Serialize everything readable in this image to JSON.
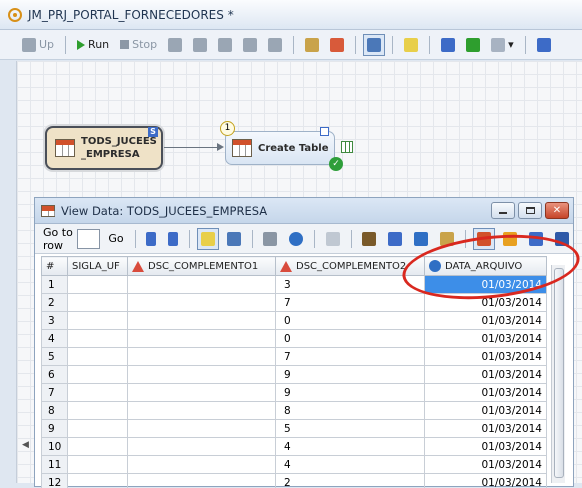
{
  "window": {
    "title": "JM_PRJ_PORTAL_FORNECEDORES *"
  },
  "toolbar": {
    "up_label": "Up",
    "run_label": "Run",
    "stop_label": "Stop"
  },
  "flow": {
    "source_node_line1": "TODS_JUCEES",
    "source_node_line2": "_EMPRESA",
    "source_badge": "S",
    "step_number": "1",
    "target_node_label": "Create Table"
  },
  "view_data": {
    "title": "View Data: TODS_JUCEES_EMPRESA",
    "goto_label": "Go to row",
    "go_button": "Go",
    "columns": [
      "#",
      "SIGLA_UF",
      "DSC_COMPLEMENTO1",
      "DSC_COMPLEMENTO2",
      "DATA_ARQUIVO"
    ],
    "rows": [
      {
        "n": "1",
        "c2": "3",
        "date": "01/03/2014"
      },
      {
        "n": "2",
        "c2": "7",
        "date": "01/03/2014"
      },
      {
        "n": "3",
        "c2": "0",
        "date": "01/03/2014"
      },
      {
        "n": "4",
        "c2": "0",
        "date": "01/03/2014"
      },
      {
        "n": "5",
        "c2": "7",
        "date": "01/03/2014"
      },
      {
        "n": "6",
        "c2": "9",
        "date": "01/03/2014"
      },
      {
        "n": "7",
        "c2": "9",
        "date": "01/03/2014"
      },
      {
        "n": "8",
        "c2": "8",
        "date": "01/03/2014"
      },
      {
        "n": "9",
        "c2": "5",
        "date": "01/03/2014"
      },
      {
        "n": "10",
        "c2": "4",
        "date": "01/03/2014"
      },
      {
        "n": "11",
        "c2": "4",
        "date": "01/03/2014"
      },
      {
        "n": "12",
        "c2": "2",
        "date": "01/03/2014"
      }
    ]
  },
  "colors": {
    "selection": "#3d8ee8",
    "annotation": "#d9281f"
  }
}
